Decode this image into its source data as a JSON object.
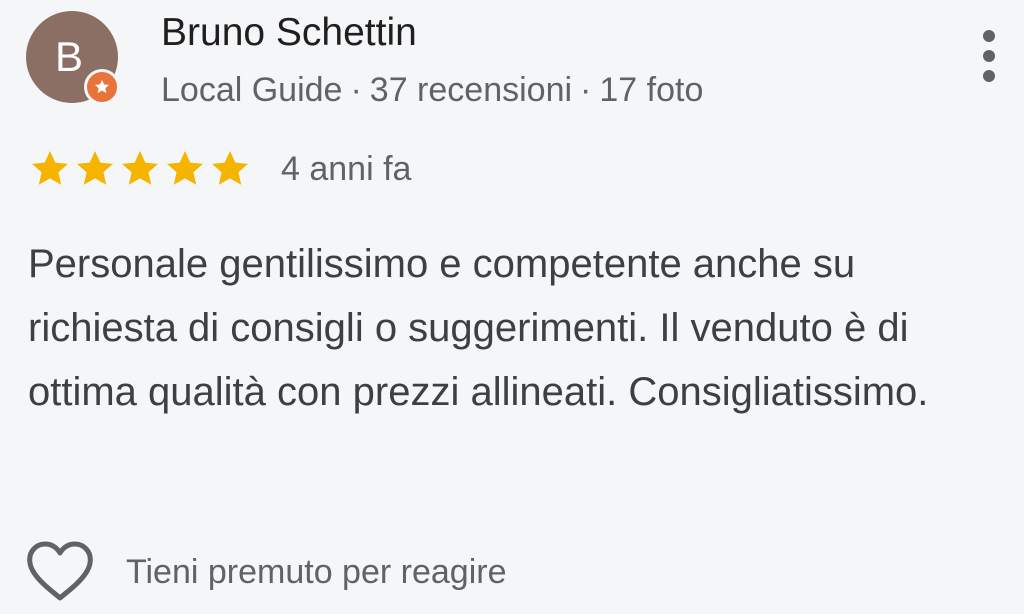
{
  "author": {
    "avatar_initial": "B",
    "name": "Bruno Schettin",
    "badge_icon": "local-guide-star-icon",
    "meta": {
      "level": "Local Guide",
      "separator": "·",
      "reviews": "37 recensioni",
      "photos": "17 foto"
    }
  },
  "menu": {
    "icon": "more-vert-icon"
  },
  "review": {
    "rating": 5,
    "rating_max": 5,
    "date": "4 anni fa",
    "text": "Personale gentilissimo e competente anche su richiesta di consigli o suggerimenti. Il venduto è di ottima qualità con prezzi allineati. Consigliatissimo."
  },
  "reaction": {
    "icon": "heart-outline-icon",
    "label": "Tieni premuto per reagire"
  },
  "colors": {
    "background": "#f5f6f8",
    "avatar": "#8c6f64",
    "badge": "#e8743b",
    "star": "#f4b400",
    "secondary_text": "#5f6368"
  }
}
